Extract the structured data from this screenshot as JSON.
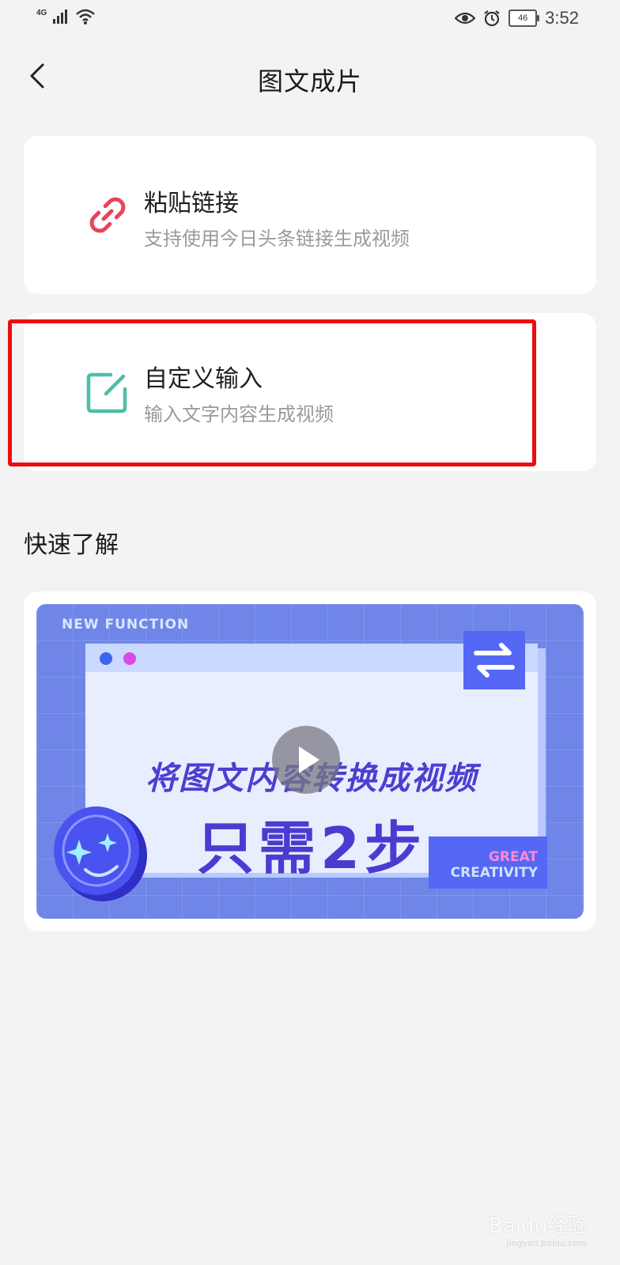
{
  "status_bar": {
    "network": "4G",
    "battery": "46",
    "time": "3:52"
  },
  "nav": {
    "title": "图文成片"
  },
  "options": [
    {
      "title": "粘贴链接",
      "subtitle": "支持使用今日头条链接生成视频",
      "icon": "link-icon",
      "icon_color": "#e8445a"
    },
    {
      "title": "自定义输入",
      "subtitle": "输入文字内容生成视频",
      "icon": "edit-icon",
      "icon_color": "#4cbfa8"
    }
  ],
  "section": {
    "title": "快速了解"
  },
  "video": {
    "badge_top": "NEW FUNCTION",
    "line1": "将图文内容转换成视频",
    "line2": "只需2步",
    "badge_bottom_1": "GREAT",
    "badge_bottom_2": "CREATIVITY"
  },
  "colors": {
    "highlight": "#ee0d0d",
    "thumb_bg": "#6f86e8",
    "thumb_text": "#4a3cd0"
  },
  "watermark": {
    "text": "Baidu经验",
    "sub": "jingyan.baidu.com"
  }
}
